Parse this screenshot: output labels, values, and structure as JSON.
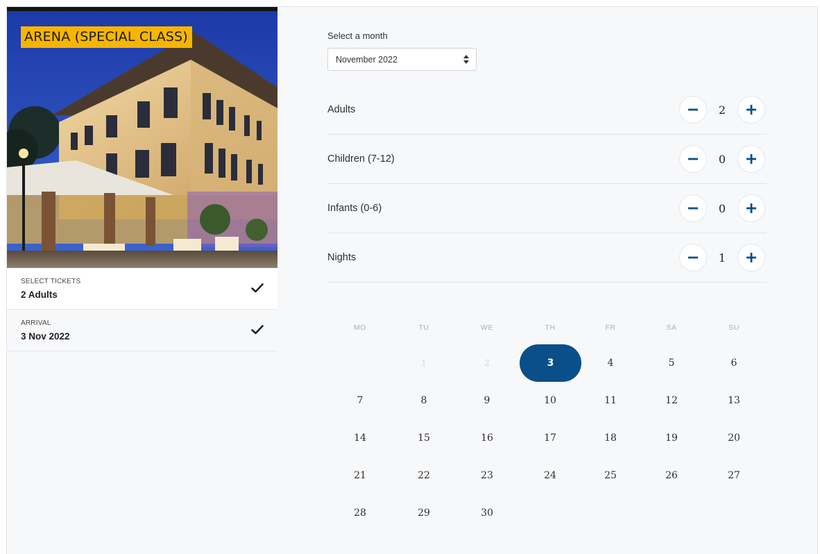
{
  "hotel": {
    "badge": "ARENA (SPECIAL CLASS)"
  },
  "summary": [
    {
      "label": "SELECT TICKETS",
      "value": "2 Adults"
    },
    {
      "label": "ARRIVAL",
      "value": "3 Nov 2022"
    }
  ],
  "month": {
    "label": "Select a month",
    "selected": "November 2022"
  },
  "counters": [
    {
      "label": "Adults",
      "value": "2"
    },
    {
      "label": "Children (7-12)",
      "value": "0"
    },
    {
      "label": "Infants (0-6)",
      "value": "0"
    },
    {
      "label": "Nights",
      "value": "1"
    }
  ],
  "calendar": {
    "weekdays": [
      "MO",
      "TU",
      "WE",
      "TH",
      "FR",
      "SA",
      "SU"
    ],
    "selected_day": "3",
    "weeks": [
      [
        "",
        "1",
        "2",
        "3",
        "4",
        "5",
        "6"
      ],
      [
        "7",
        "8",
        "9",
        "10",
        "11",
        "12",
        "13"
      ],
      [
        "14",
        "15",
        "16",
        "17",
        "18",
        "19",
        "20"
      ],
      [
        "21",
        "22",
        "23",
        "24",
        "25",
        "26",
        "27"
      ],
      [
        "28",
        "29",
        "30",
        "",
        "",
        "",
        ""
      ]
    ],
    "disabled_days": [
      "1",
      "2"
    ]
  },
  "colors": {
    "accent": "#0a4f8a",
    "badge": "#f7b500"
  }
}
